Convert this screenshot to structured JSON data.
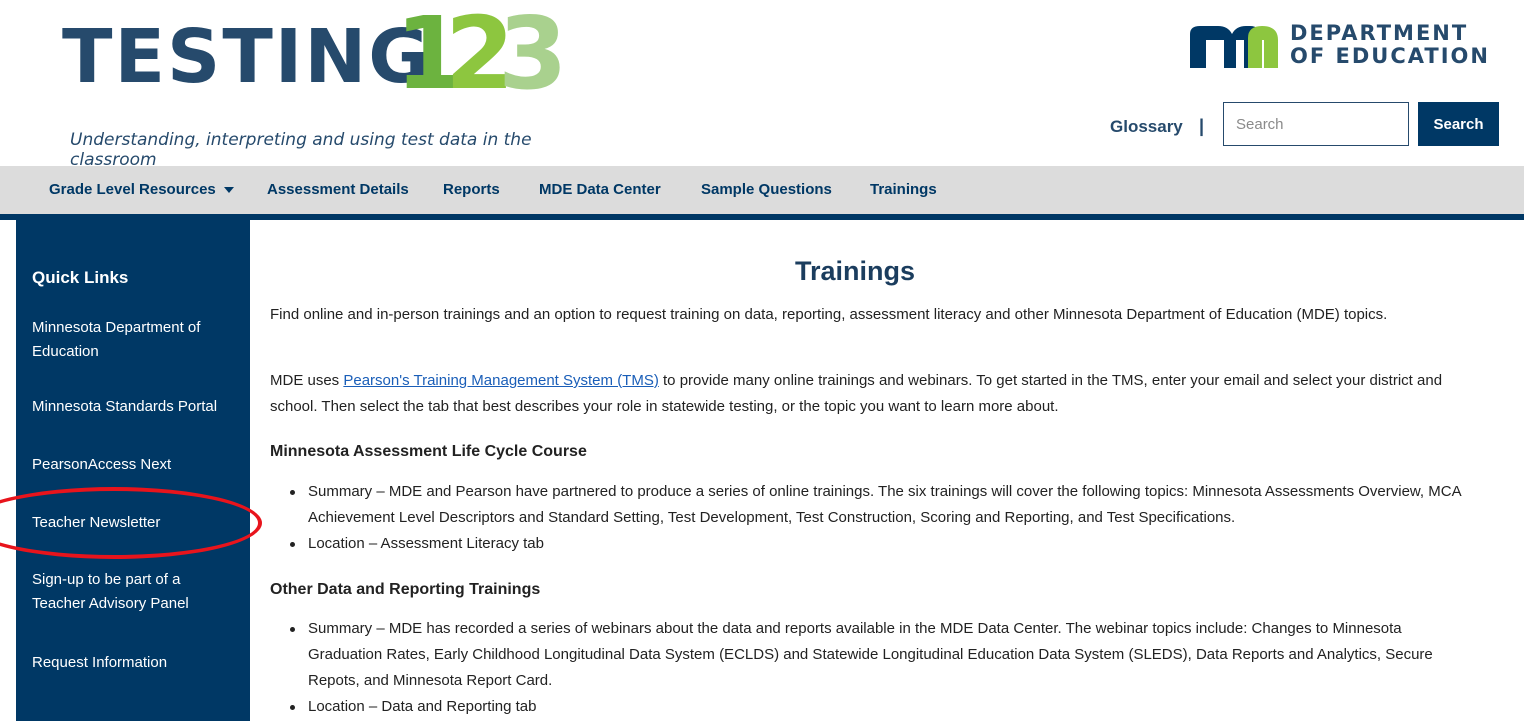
{
  "header": {
    "logo_word": "TESTING",
    "logo_digits": [
      "1",
      "2",
      "3"
    ],
    "tagline": "Understanding, interpreting and using test data in the classroom",
    "mde_line1": "DEPARTMENT",
    "mde_line2": "OF EDUCATION",
    "glossary_label": "Glossary",
    "separator": "|",
    "search_placeholder": "Search",
    "search_button": "Search"
  },
  "nav": {
    "items": [
      {
        "label": "Grade Level Resources",
        "dropdown": true
      },
      {
        "label": "Assessment Details"
      },
      {
        "label": "Reports"
      },
      {
        "label": "MDE Data Center"
      },
      {
        "label": "Sample Questions"
      },
      {
        "label": "Trainings"
      }
    ]
  },
  "sidebar": {
    "title": "Quick Links",
    "items": [
      {
        "label": "Minnesota Department of Education"
      },
      {
        "label": "Minnesota Standards Portal"
      },
      {
        "label": "PearsonAccess Next"
      },
      {
        "label": "Teacher Newsletter",
        "highlighted": true
      },
      {
        "label": "Sign-up to be part of a Teacher Advisory Panel"
      },
      {
        "label": "Request Information"
      }
    ]
  },
  "main": {
    "title": "Trainings",
    "intro": "Find online and in-person trainings and an option to request training on data, reporting, assessment literacy and other Minnesota Department of Education (MDE) topics.",
    "tms_before": "MDE uses ",
    "tms_link": "Pearson's Training Management System (TMS)",
    "tms_after": " to provide many online trainings and webinars. To get started in the TMS, enter your email and select your district and school. Then select the tab that best describes your role in statewide testing, or the topic you want to learn more about.",
    "sections": [
      {
        "heading": "Minnesota Assessment Life Cycle Course",
        "bullets": [
          "Summary – MDE and Pearson have partnered to produce a series of online trainings. The six trainings will cover the following topics: Minnesota Assessments Overview, MCA Achievement Level Descriptors and Standard Setting, Test Development, Test Construction, Scoring and Reporting, and Test Specifications.",
          "Location – Assessment Literacy tab"
        ]
      },
      {
        "heading": "Other Data and Reporting Trainings",
        "bullets": [
          "Summary – MDE has recorded a series of webinars about the data and reports available in the MDE Data Center. The webinar topics include: Changes to Minnesota Graduation Rates, Early Childhood Longitudinal Data System (ECLDS) and Statewide Longitudinal Education Data System (SLEDS), Data Reports and Analytics, Secure Repots, and Minnesota Report Card.",
          "Location – Data and Reporting tab"
        ]
      }
    ]
  },
  "colors": {
    "navy": "#003865",
    "logo_blue": "#264a6c",
    "logo_green": "#8dc63f",
    "nav_bg": "#dcdcdc",
    "link": "#1a5eb8",
    "highlight_ring": "#e8141c"
  }
}
